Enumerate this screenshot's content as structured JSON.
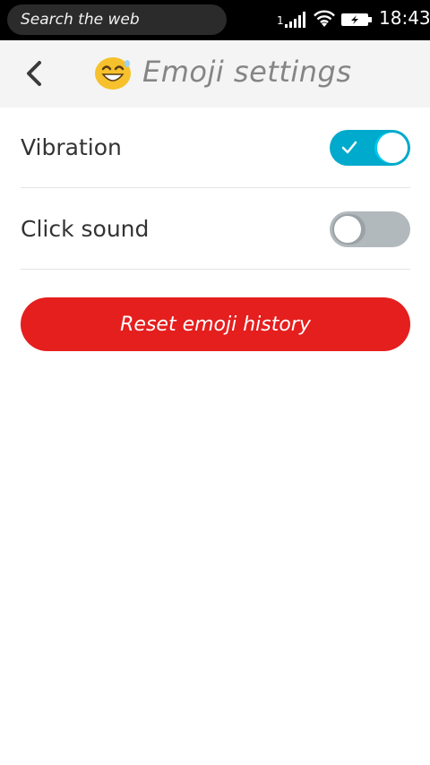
{
  "statusbar": {
    "search_placeholder": "Search the web",
    "sim_number": "1",
    "time": "18:43"
  },
  "header": {
    "title": "Emoji settings"
  },
  "settings": [
    {
      "label": "Vibration",
      "enabled": true
    },
    {
      "label": "Click sound",
      "enabled": false
    }
  ],
  "reset_button": {
    "label": "Reset emoji history"
  },
  "colors": {
    "toggle_on": "#00aacc",
    "toggle_off": "#b2b9bd",
    "danger": "#e51e1e"
  },
  "icons": [
    "signal-icon",
    "wifi-icon",
    "battery-charging-icon",
    "back-chevron-icon",
    "smiling-emoji-icon",
    "check-icon"
  ]
}
